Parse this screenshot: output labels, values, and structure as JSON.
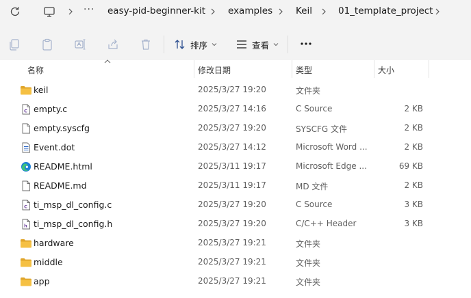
{
  "breadcrumb": {
    "overflow_label": "···",
    "items": [
      "easy-pid-beginner-kit",
      "examples",
      "Keil",
      "01_template_project"
    ]
  },
  "toolbar": {
    "sort_label": "排序",
    "view_label": "查看"
  },
  "columns": {
    "name": "名称",
    "date": "修改日期",
    "type": "类型",
    "size": "大小"
  },
  "files": [
    {
      "name": "keil",
      "date": "2025/3/27 19:20",
      "type": "文件夹",
      "size": "",
      "icon": "folder-icon"
    },
    {
      "name": "empty.c",
      "date": "2025/3/27 14:16",
      "type": "C Source",
      "size": "2 KB",
      "icon": "c-source-file-icon"
    },
    {
      "name": "empty.syscfg",
      "date": "2025/3/27 19:20",
      "type": "SYSCFG 文件",
      "size": "2 KB",
      "icon": "generic-file-icon"
    },
    {
      "name": "Event.dot",
      "date": "2025/3/27 14:12",
      "type": "Microsoft Word ...",
      "size": "2 KB",
      "icon": "word-file-icon"
    },
    {
      "name": "README.html",
      "date": "2025/3/11 19:17",
      "type": "Microsoft Edge ...",
      "size": "69 KB",
      "icon": "edge-file-icon"
    },
    {
      "name": "README.md",
      "date": "2025/3/11 19:17",
      "type": "MD 文件",
      "size": "2 KB",
      "icon": "generic-file-icon"
    },
    {
      "name": "ti_msp_dl_config.c",
      "date": "2025/3/27 19:20",
      "type": "C Source",
      "size": "3 KB",
      "icon": "c-source-file-icon"
    },
    {
      "name": "ti_msp_dl_config.h",
      "date": "2025/3/27 19:20",
      "type": "C/C++ Header",
      "size": "3 KB",
      "icon": "c-header-file-icon"
    },
    {
      "name": "hardware",
      "date": "2025/3/27 19:21",
      "type": "文件夹",
      "size": "",
      "icon": "folder-icon"
    },
    {
      "name": "middle",
      "date": "2025/3/27 19:21",
      "type": "文件夹",
      "size": "",
      "icon": "folder-icon"
    },
    {
      "name": "app",
      "date": "2025/3/27 19:21",
      "type": "文件夹",
      "size": "",
      "icon": "folder-icon"
    }
  ],
  "colors": {
    "folder": "#f5c043",
    "folder_dark": "#e0a52a",
    "word": "#2b66c4",
    "edge_blue": "#1d7fd8",
    "edge_green": "#3ec47a"
  }
}
